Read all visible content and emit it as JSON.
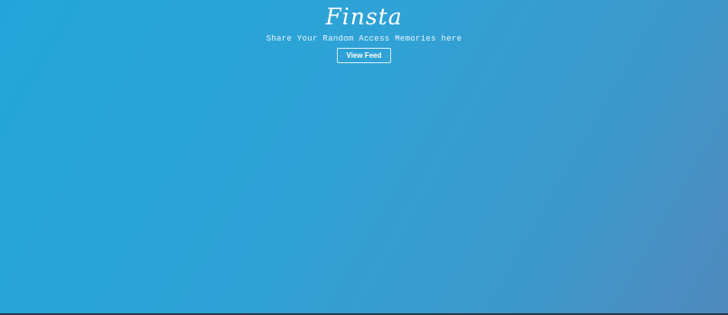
{
  "hero": {
    "brand": "Finsta",
    "tagline": "Share Your Random Access Memories here",
    "view_feed_label": "View Feed"
  },
  "colors": {
    "gradient_start": "#22a6d9",
    "gradient_end": "#508abd",
    "text": "#ffffff"
  }
}
